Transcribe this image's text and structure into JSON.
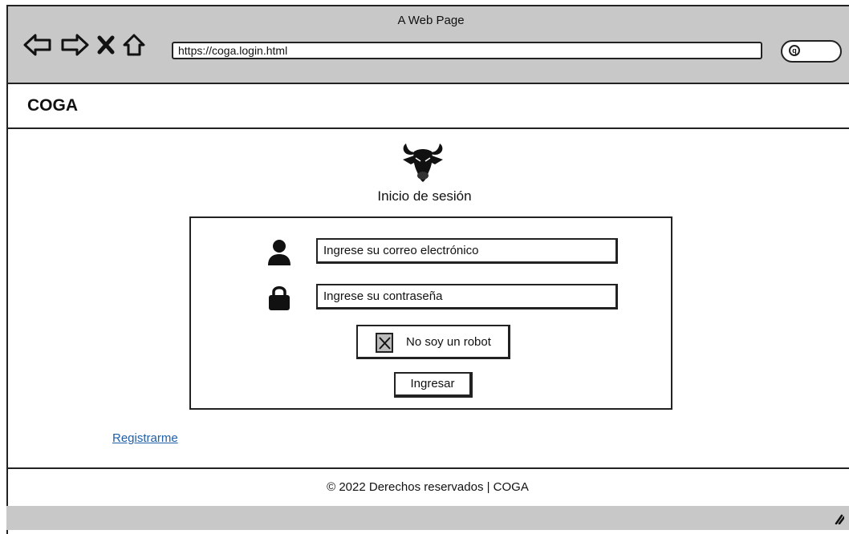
{
  "window": {
    "title": "A Web Page"
  },
  "browser": {
    "url": "https://coga.login.html",
    "icons": [
      "back-icon",
      "forward-icon",
      "close-icon",
      "home-icon",
      "search-icon"
    ]
  },
  "header": {
    "brand": "COGA"
  },
  "login": {
    "title": "Inicio de sesión",
    "email_placeholder": "Ingrese su correo electrónico",
    "password_placeholder": "Ingrese su contraseña",
    "captcha_label": "No soy un robot",
    "submit_label": "Ingresar"
  },
  "register_link": "Registrarme",
  "footer": {
    "copyright": "© 2022 Derechos reservados | COGA"
  },
  "colors": {
    "chrome": "#c8c8c8",
    "link": "#1f5fa8",
    "border": "#222222"
  }
}
